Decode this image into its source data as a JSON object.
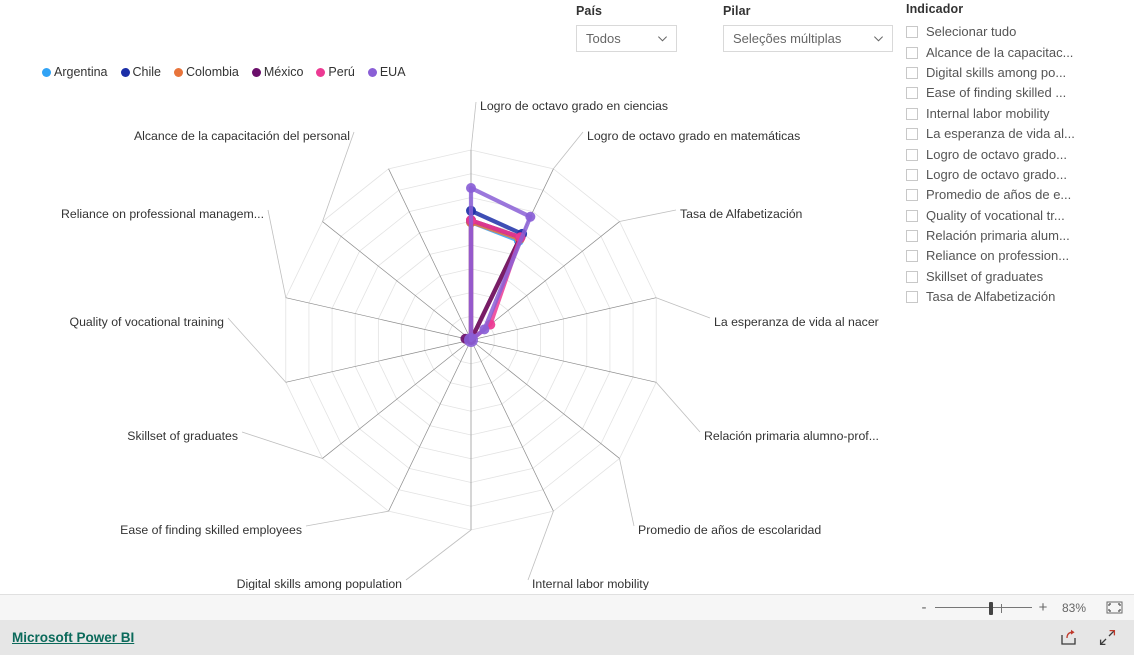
{
  "legend": {
    "items": [
      {
        "label": "Argentina",
        "color": "#31a3f5"
      },
      {
        "label": "Chile",
        "color": "#1c2fa8"
      },
      {
        "label": "Colombia",
        "color": "#e8743b"
      },
      {
        "label": "México",
        "color": "#6b0f6b"
      },
      {
        "label": "Perú",
        "color": "#ec3a93"
      },
      {
        "label": "EUA",
        "color": "#8a5fd6"
      }
    ]
  },
  "slicers": {
    "pais": {
      "title": "País",
      "value": "Todos",
      "icon": "chevron-down-icon"
    },
    "pilar": {
      "title": "Pilar",
      "value": "Seleções múltiplas",
      "icon": "chevron-down-icon"
    }
  },
  "indicador": {
    "title": "Indicador",
    "items": [
      {
        "label": "Selecionar tudo",
        "checked": false
      },
      {
        "label": "Alcance de la capacitac...",
        "checked": false
      },
      {
        "label": "Digital skills among po...",
        "checked": false
      },
      {
        "label": "Ease of finding skilled ...",
        "checked": false
      },
      {
        "label": "Internal labor mobility",
        "checked": false
      },
      {
        "label": "La esperanza de vida al...",
        "checked": false
      },
      {
        "label": "Logro de octavo grado...",
        "checked": false
      },
      {
        "label": "Logro de octavo grado...",
        "checked": false
      },
      {
        "label": "Promedio de años de e...",
        "checked": false
      },
      {
        "label": "Quality of vocational tr...",
        "checked": false
      },
      {
        "label": "Relación primaria alum...",
        "checked": false
      },
      {
        "label": "Reliance on profession...",
        "checked": false
      },
      {
        "label": "Skillset of graduates",
        "checked": false
      },
      {
        "label": "Tasa de Alfabetización",
        "checked": false
      }
    ]
  },
  "statusbar": {
    "zoom_out_label": "-",
    "zoom_in_label": "+",
    "zoom_percent": "83%",
    "fit_icon": "fit-to-page-icon"
  },
  "footer": {
    "brand": "Microsoft Power BI",
    "share_icon": "share-icon",
    "fullscreen_icon": "fullscreen-icon"
  },
  "chart_data": {
    "type": "radar",
    "title": "",
    "grid": true,
    "legend_position": "top-left",
    "rings": 8,
    "categories": [
      "Logro de octavo grado en ciencias",
      "Logro de octavo grado en matemáticas",
      "Tasa de Alfabetización",
      "La esperanza de vida al nacer",
      "Relación primaria alumno-prof...",
      "Promedio de años de escolaridad",
      "Internal labor mobility",
      "Digital skills among population",
      "Ease of finding skilled employees",
      "Skillset of graduates",
      "Quality of vocational training",
      "Reliance on professional managem...",
      "Alcance de la capacitación del personal",
      ""
    ],
    "rlim": [
      0,
      1
    ],
    "series": [
      {
        "name": "Argentina",
        "color": "#31a3f5",
        "values": [
          0.62,
          0.58,
          0.0,
          0.0,
          0.0,
          0.0,
          0.0,
          0.0,
          0.0,
          0.0,
          0.0,
          0.0,
          0.0,
          0.0
        ]
      },
      {
        "name": "Chile",
        "color": "#1c2fa8",
        "values": [
          0.68,
          0.62,
          0.0,
          0.0,
          0.0,
          0.0,
          0.0,
          0.0,
          0.0,
          0.0,
          0.0,
          0.0,
          0.0,
          0.0
        ]
      },
      {
        "name": "Colombia",
        "color": "#e8743b",
        "values": [
          0.62,
          0.59,
          0.0,
          0.0,
          0.0,
          0.0,
          0.0,
          0.0,
          0.0,
          0.0,
          0.0,
          0.0,
          0.0,
          0.0
        ]
      },
      {
        "name": "México",
        "color": "#6b0f6b",
        "values": [
          0.63,
          0.6,
          0.0,
          0.0,
          0.0,
          0.0,
          0.0,
          0.0,
          0.0,
          0.0,
          0.0,
          0.03,
          0.0,
          0.0
        ]
      },
      {
        "name": "Perú",
        "color": "#ec3a93",
        "values": [
          0.63,
          0.6,
          0.13,
          0.0,
          0.0,
          0.0,
          0.0,
          0.0,
          0.0,
          0.0,
          0.0,
          0.0,
          0.0,
          0.0
        ]
      },
      {
        "name": "EUA",
        "color": "#8a5fd6",
        "values": [
          0.8,
          0.72,
          0.09,
          0.0,
          0.0,
          0.0,
          0.0,
          0.0,
          0.0,
          0.0,
          0.0,
          0.0,
          0.0,
          0.0
        ]
      }
    ]
  }
}
